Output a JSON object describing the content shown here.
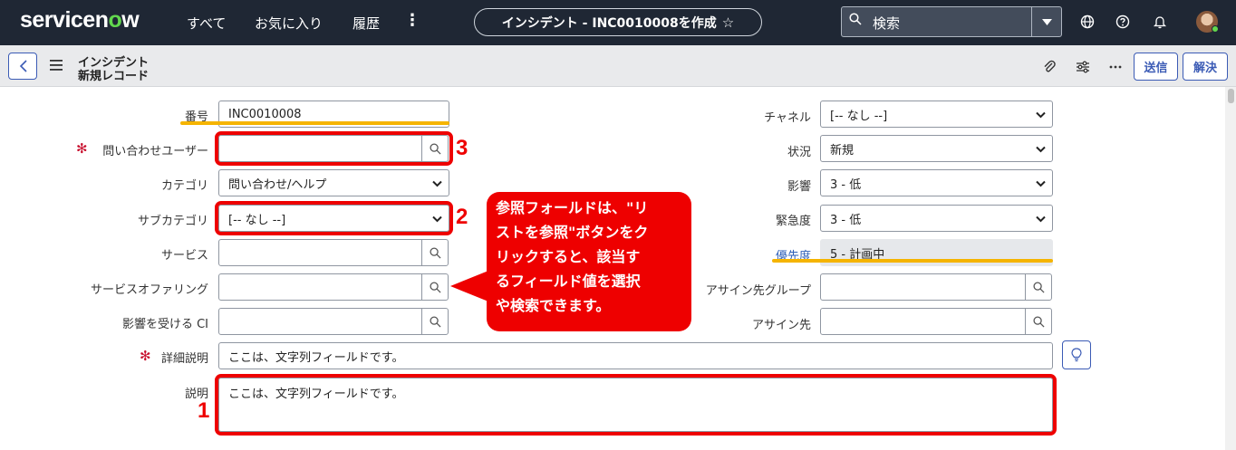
{
  "nav": {
    "logo_text_a": "servicen",
    "logo_text_b": "o",
    "logo_text_c": "w",
    "links": [
      "すべて",
      "お気に入り",
      "履歴"
    ],
    "more": "⋮",
    "record_title": "インシデント - INC0010008を作成",
    "search_placeholder": "検索"
  },
  "header": {
    "title_line1": "インシデント",
    "title_line2": "新規レコード",
    "submit_label": "送信",
    "resolve_label": "解決"
  },
  "form": {
    "number": {
      "label": "番号",
      "value": "INC0010008"
    },
    "caller": {
      "label": "問い合わせユーザー",
      "value": ""
    },
    "category": {
      "label": "カテゴリ",
      "value": "問い合わせ/ヘルプ"
    },
    "subcategory": {
      "label": "サブカテゴリ",
      "value": "[-- なし --]"
    },
    "service": {
      "label": "サービス",
      "value": ""
    },
    "service_offering": {
      "label": "サービスオファリング",
      "value": ""
    },
    "affected_ci": {
      "label": "影響を受ける CI",
      "value": ""
    },
    "channel": {
      "label": "チャネル",
      "value": "[-- なし --]"
    },
    "state": {
      "label": "状況",
      "value": "新規"
    },
    "impact": {
      "label": "影響",
      "value": "3 - 低"
    },
    "urgency": {
      "label": "緊急度",
      "value": "3 - 低"
    },
    "priority": {
      "label": "優先度",
      "value": "5 - 計画中"
    },
    "assignment_group": {
      "label": "アサイン先グループ",
      "value": ""
    },
    "assigned_to": {
      "label": "アサイン先",
      "value": ""
    },
    "short_description": {
      "label": "詳細説明",
      "value": "ここは、文字列フィールドです。"
    },
    "description": {
      "label": "説明",
      "value": "ここは、文字列フィールドです。"
    },
    "required_mark": "✻"
  },
  "annotations": {
    "num1": "1",
    "num2": "2",
    "num3": "3",
    "callout_line1": "参照フォールドは、\"リ",
    "callout_line2": "ストを参照\"ボタンをク",
    "callout_line3": "リックすると、該当す",
    "callout_line4": "るフィールド値を選択",
    "callout_line5": "や検索できます。",
    "highlight_color": "#ee0000",
    "underline_color": "#f5b400"
  }
}
